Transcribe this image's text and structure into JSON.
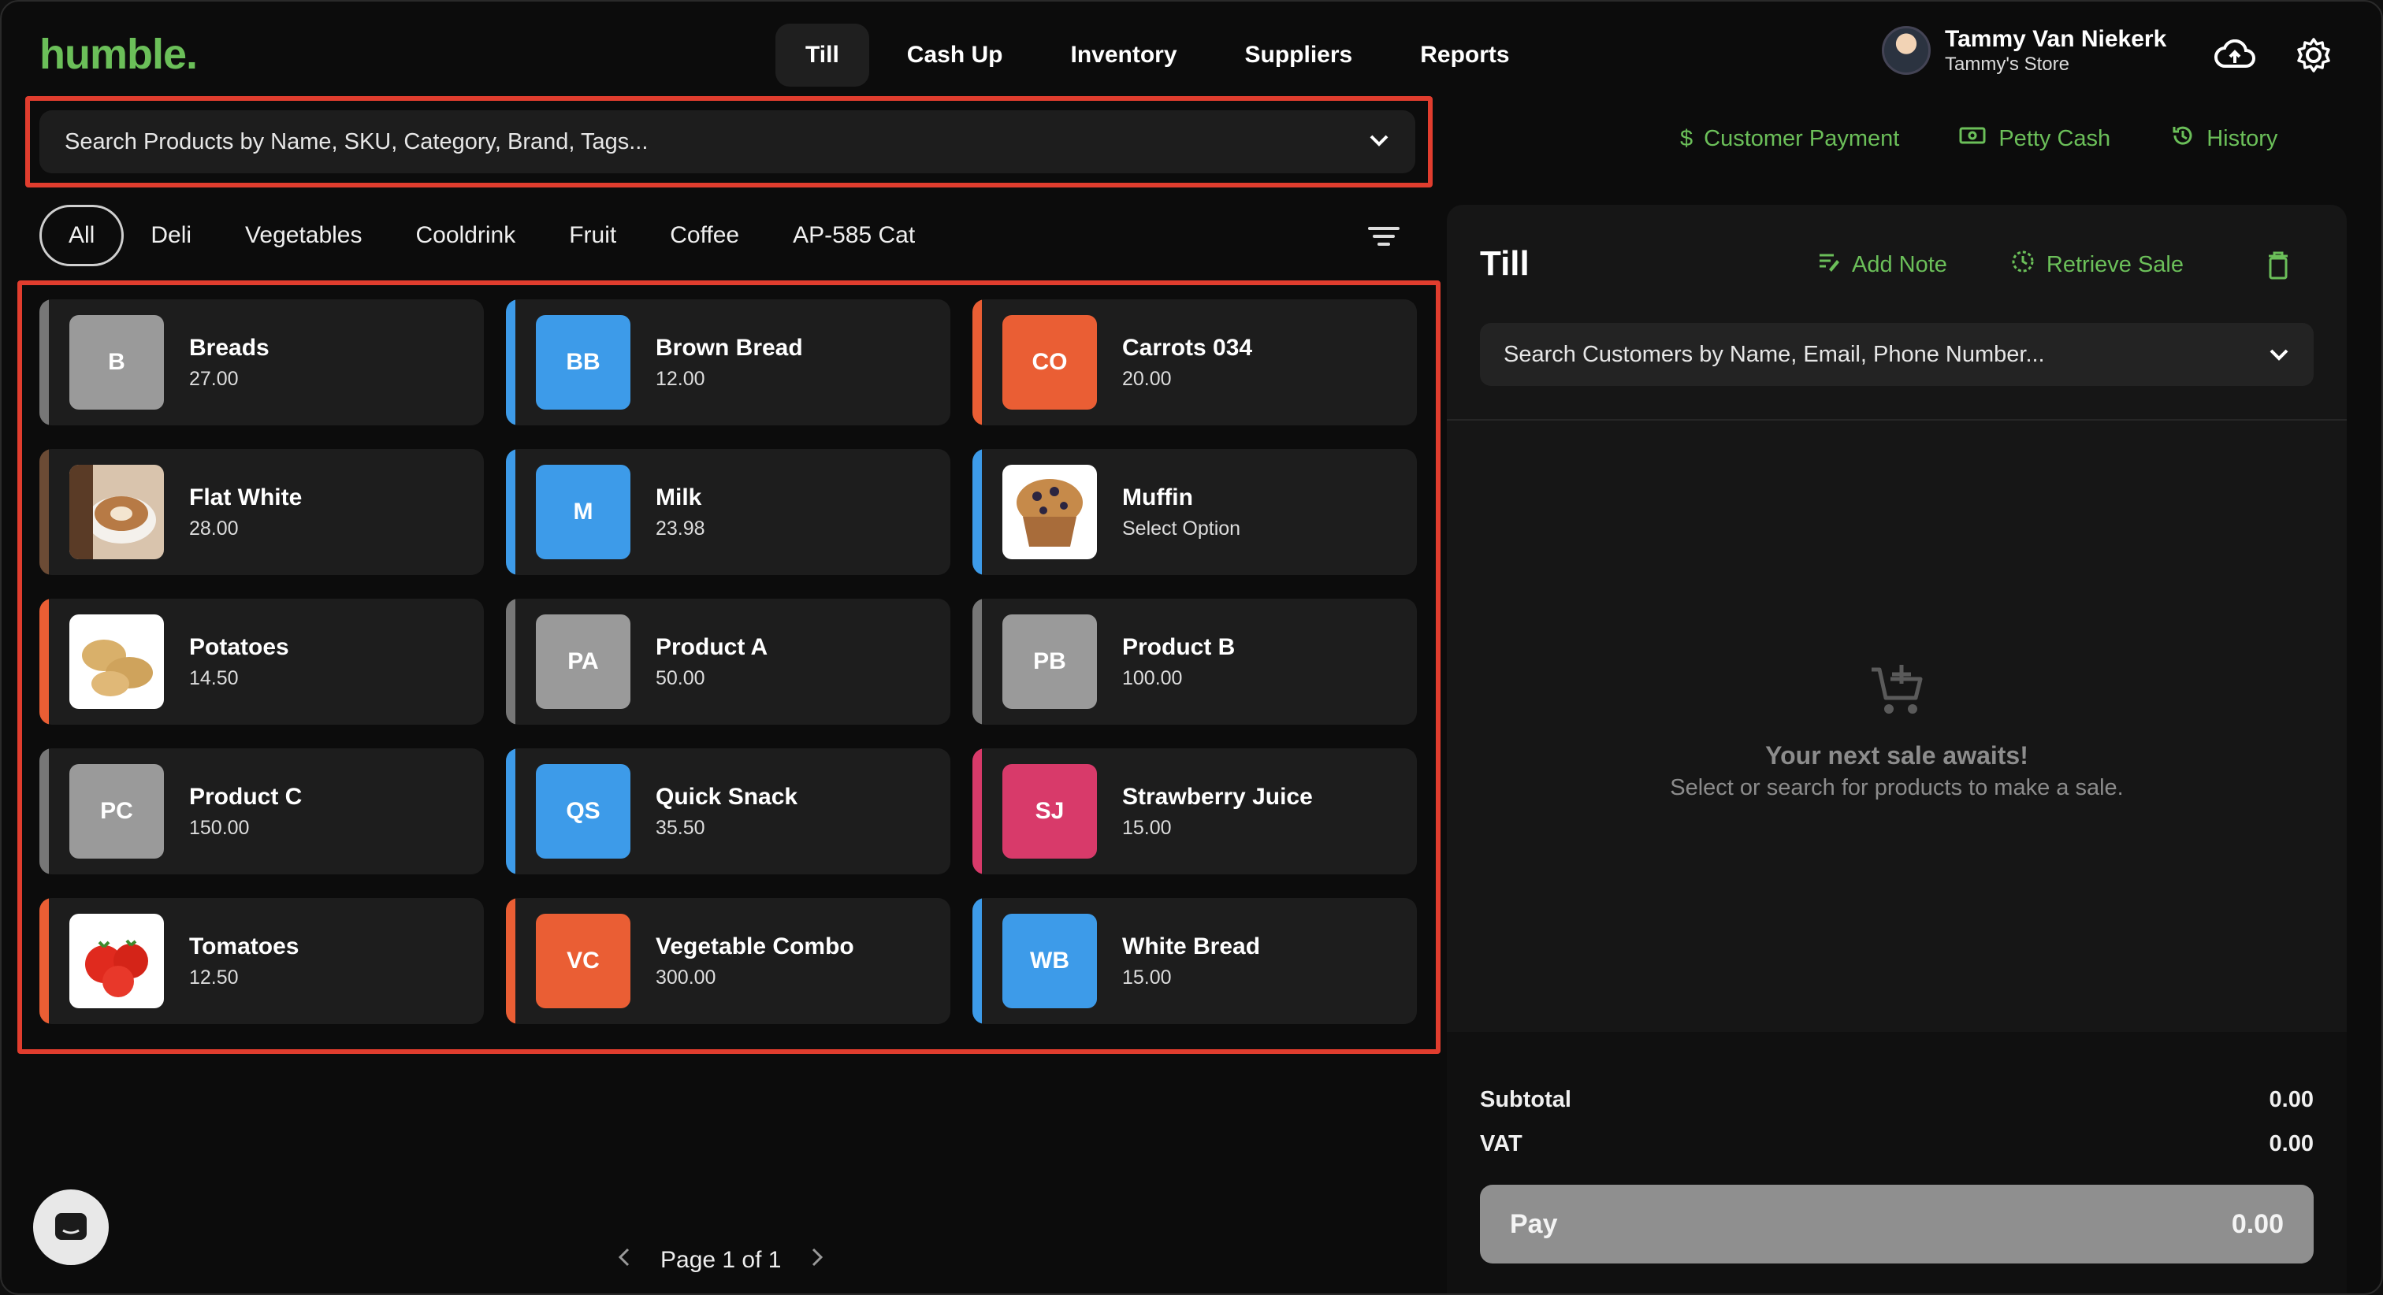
{
  "brand": {
    "logo": "humble."
  },
  "nav": {
    "items": [
      {
        "label": "Till",
        "active": true
      },
      {
        "label": "Cash Up",
        "active": false
      },
      {
        "label": "Inventory",
        "active": false
      },
      {
        "label": "Suppliers",
        "active": false
      },
      {
        "label": "Reports",
        "active": false
      }
    ]
  },
  "user": {
    "name": "Tammy Van Niekerk",
    "store": "Tammy's Store"
  },
  "icons": {
    "upload": "cloud-upload-icon",
    "settings": "gear-icon"
  },
  "search": {
    "placeholder": "Search Products by Name, SKU, Category, Brand, Tags..."
  },
  "actions": {
    "customer_payment": "Customer Payment",
    "petty_cash": "Petty Cash",
    "history": "History"
  },
  "categories": [
    "All",
    "Deli",
    "Vegetables",
    "Cooldrink",
    "Fruit",
    "Coffee",
    "AP-585 Cat"
  ],
  "active_category": "All",
  "products": [
    {
      "name": "Breads",
      "price": "27.00",
      "initials": "B",
      "color": "#9a9a9a",
      "stripe": "#777777",
      "image": null
    },
    {
      "name": "Brown Bread",
      "price": "12.00",
      "initials": "BB",
      "color": "#3d9be9",
      "stripe": "#3d9be9",
      "image": null
    },
    {
      "name": "Carrots 034",
      "price": "20.00",
      "initials": "CO",
      "color": "#ea5e34",
      "stripe": "#ea5e34",
      "image": null
    },
    {
      "name": "Flat White",
      "price": "28.00",
      "initials": "",
      "color": "#6b4b35",
      "stripe": "#6b4b35",
      "image": "coffee-cup"
    },
    {
      "name": "Milk",
      "price": "23.98",
      "initials": "M",
      "color": "#3d9be9",
      "stripe": "#3d9be9",
      "image": null
    },
    {
      "name": "Muffin",
      "price": "Select Option",
      "initials": "",
      "color": "#3d9be9",
      "stripe": "#3d9be9",
      "image": "muffin"
    },
    {
      "name": "Potatoes",
      "price": "14.50",
      "initials": "",
      "color": "#ea5e34",
      "stripe": "#ea5e34",
      "image": "potatoes"
    },
    {
      "name": "Product A",
      "price": "50.00",
      "initials": "PA",
      "color": "#9a9a9a",
      "stripe": "#777777",
      "image": null
    },
    {
      "name": "Product B",
      "price": "100.00",
      "initials": "PB",
      "color": "#9a9a9a",
      "stripe": "#777777",
      "image": null
    },
    {
      "name": "Product C",
      "price": "150.00",
      "initials": "PC",
      "color": "#9a9a9a",
      "stripe": "#777777",
      "image": null
    },
    {
      "name": "Quick Snack",
      "price": "35.50",
      "initials": "QS",
      "color": "#3d9be9",
      "stripe": "#3d9be9",
      "image": null
    },
    {
      "name": "Strawberry Juice",
      "price": "15.00",
      "initials": "SJ",
      "color": "#d83a6a",
      "stripe": "#d83a6a",
      "image": null
    },
    {
      "name": "Tomatoes",
      "price": "12.50",
      "initials": "",
      "color": "#ea5e34",
      "stripe": "#ea5e34",
      "image": "tomatoes"
    },
    {
      "name": "Vegetable Combo",
      "price": "300.00",
      "initials": "VC",
      "color": "#ea5e34",
      "stripe": "#ea5e34",
      "image": null
    },
    {
      "name": "White Bread",
      "price": "15.00",
      "initials": "WB",
      "color": "#3d9be9",
      "stripe": "#3d9be9",
      "image": null
    }
  ],
  "pagination": {
    "label": "Page 1 of 1"
  },
  "till": {
    "title": "Till",
    "add_note": "Add Note",
    "retrieve_sale": "Retrieve Sale",
    "customer_search_placeholder": "Search Customers by Name, Email, Phone Number...",
    "empty_title": "Your next sale awaits!",
    "empty_subtitle": "Select or search for products to make a sale.",
    "subtotal_label": "Subtotal",
    "subtotal_value": "0.00",
    "vat_label": "VAT",
    "vat_value": "0.00",
    "pay_label": "Pay",
    "pay_value": "0.00"
  },
  "colors": {
    "accent": "#6bbf59",
    "highlight": "#e13d2e"
  }
}
